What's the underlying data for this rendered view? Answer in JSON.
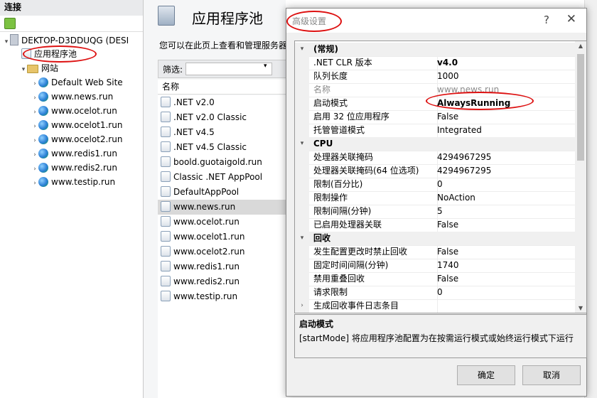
{
  "connections": {
    "header": "连接",
    "server": "DEKTOP-D3DDUQG (DESI",
    "app_pools": "应用程序池",
    "sites": "网站",
    "site_list": [
      "Default Web Site",
      "www.news.run",
      "www.ocelot.run",
      "www.ocelot1.run",
      "www.ocelot2.run",
      "www.redis1.run",
      "www.redis2.run",
      "www.testip.run"
    ]
  },
  "pools_page": {
    "title": "应用程序池",
    "description": "您可以在此页上查看和管理服务器",
    "filter_label": "筛选:",
    "column_name": "名称",
    "pools": [
      ".NET v2.0",
      ".NET v2.0 Classic",
      ".NET v4.5",
      ".NET v4.5 Classic",
      "boold.guotaigold.run",
      "Classic .NET AppPool",
      "DefaultAppPool",
      "www.news.run",
      "www.ocelot.run",
      "www.ocelot1.run",
      "www.ocelot2.run",
      "www.redis1.run",
      "www.redis2.run",
      "www.testip.run"
    ],
    "selected_pool": "www.news.run"
  },
  "dialog": {
    "title": "高级设置",
    "help_icon": "?",
    "close_icon": "✕",
    "sections": [
      {
        "category": "(常规)",
        "rows": [
          {
            "name": ".NET CLR 版本",
            "value": "v4.0"
          },
          {
            "name": "队列长度",
            "value": "1000"
          },
          {
            "name": "名称",
            "value": "www.news.run"
          },
          {
            "name": "启动模式",
            "value": "AlwaysRunning"
          },
          {
            "name": "启用 32 位应用程序",
            "value": "False"
          },
          {
            "name": "托管管道模式",
            "value": "Integrated"
          }
        ]
      },
      {
        "category": "CPU",
        "rows": [
          {
            "name": "处理器关联掩码",
            "value": "4294967295"
          },
          {
            "name": "处理器关联掩码(64 位选项)",
            "value": "4294967295"
          },
          {
            "name": "限制(百分比)",
            "value": "0"
          },
          {
            "name": "限制操作",
            "value": "NoAction"
          },
          {
            "name": "限制间隔(分钟)",
            "value": "5"
          },
          {
            "name": "已启用处理器关联",
            "value": "False"
          }
        ]
      },
      {
        "category": "回收",
        "rows": [
          {
            "name": "发生配置更改时禁止回收",
            "value": "False"
          },
          {
            "name": "固定时间间隔(分钟)",
            "value": "1740"
          },
          {
            "name": "禁用重叠回收",
            "value": "False"
          },
          {
            "name": "请求限制",
            "value": "0"
          },
          {
            "name": "生成回收事件日志条目",
            "value": ""
          }
        ]
      }
    ],
    "desc_title": "启动模式",
    "desc_text": "[startMode] 将应用程序池配置为在按需运行模式或始终运行模式下运行",
    "ok": "确定",
    "cancel": "取消"
  }
}
